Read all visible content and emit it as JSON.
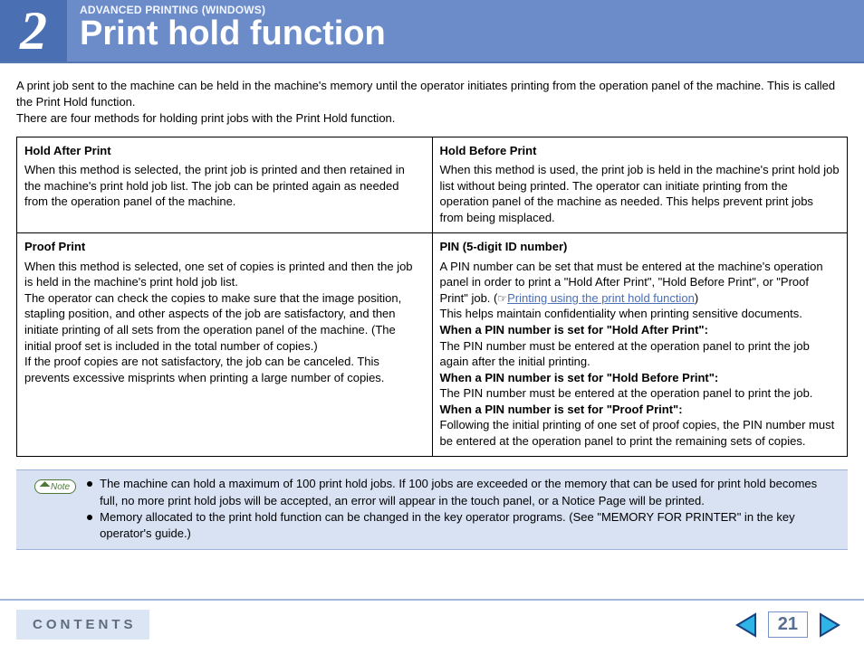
{
  "header": {
    "chapter_number": "2",
    "section_label": "ADVANCED PRINTING (WINDOWS)",
    "title": "Print hold function"
  },
  "intro": {
    "p1": "A print job sent to the machine can be held in the machine's memory until the operator initiates printing from the operation panel of the machine. This is called the Print Hold function.",
    "p2": "There are four methods for holding print jobs with the Print Hold function."
  },
  "cells": {
    "hold_after": {
      "title": "Hold After Print",
      "body": "When this method is selected, the print job is printed and then retained in the machine's print hold job list. The job can be printed again as needed from the operation panel of the machine."
    },
    "hold_before": {
      "title": "Hold Before Print",
      "body": "When this method is used, the print job is held in the machine's print hold job list without being printed. The operator can initiate printing from the operation panel of the machine as needed. This helps prevent print jobs from being misplaced."
    },
    "proof": {
      "title": "Proof Print",
      "body1": "When this method is selected, one set of copies is printed and then the job is held in the machine's print hold job list.",
      "body2": "The operator can check the copies to make sure that the image position, stapling position, and other aspects of the job are satisfactory, and then initiate printing of all sets from the operation panel of the machine. (The initial proof set is included in the total number of copies.)",
      "body3": "If the proof copies are not satisfactory, the job can be canceled. This prevents excessive misprints when printing a large number of copies."
    },
    "pin": {
      "title": "PIN (5-digit ID number)",
      "lead1": "A PIN number can be set that must be entered at the machine's operation panel in order to print a \"Hold After Print\", \"Hold Before Print\", or \"Proof Print\" job. (",
      "link_glyph": "☞",
      "link_text": "Printing using the print hold function",
      "lead2": ")",
      "lead3": "This helps maintain confidentiality when printing sensitive documents.",
      "h1": "When a PIN number is set for \"Hold After Print\":",
      "b1": "The PIN number must be entered at the operation panel to print the job again after the initial printing.",
      "h2": "When a PIN number is set for \"Hold Before Print\":",
      "b2": "The PIN number must be entered at the operation panel to print the job.",
      "h3": "When a PIN number is set for \"Proof Print\":",
      "b3": "Following the initial printing of one set of proof copies, the PIN number must be entered at the operation panel to print the remaining sets of copies."
    }
  },
  "note": {
    "label": "Note",
    "items": [
      "The machine can hold a maximum of 100 print hold jobs. If 100 jobs are exceeded or the memory that can be used for print hold becomes full, no more print hold jobs will be accepted, an error will appear in the touch panel, or a Notice Page will be printed.",
      "Memory allocated to the print hold function can be changed in the key operator programs. (See \"MEMORY FOR PRINTER\" in the key operator's guide.)"
    ]
  },
  "footer": {
    "contents_label": "CONTENTS",
    "page_number": "21"
  }
}
